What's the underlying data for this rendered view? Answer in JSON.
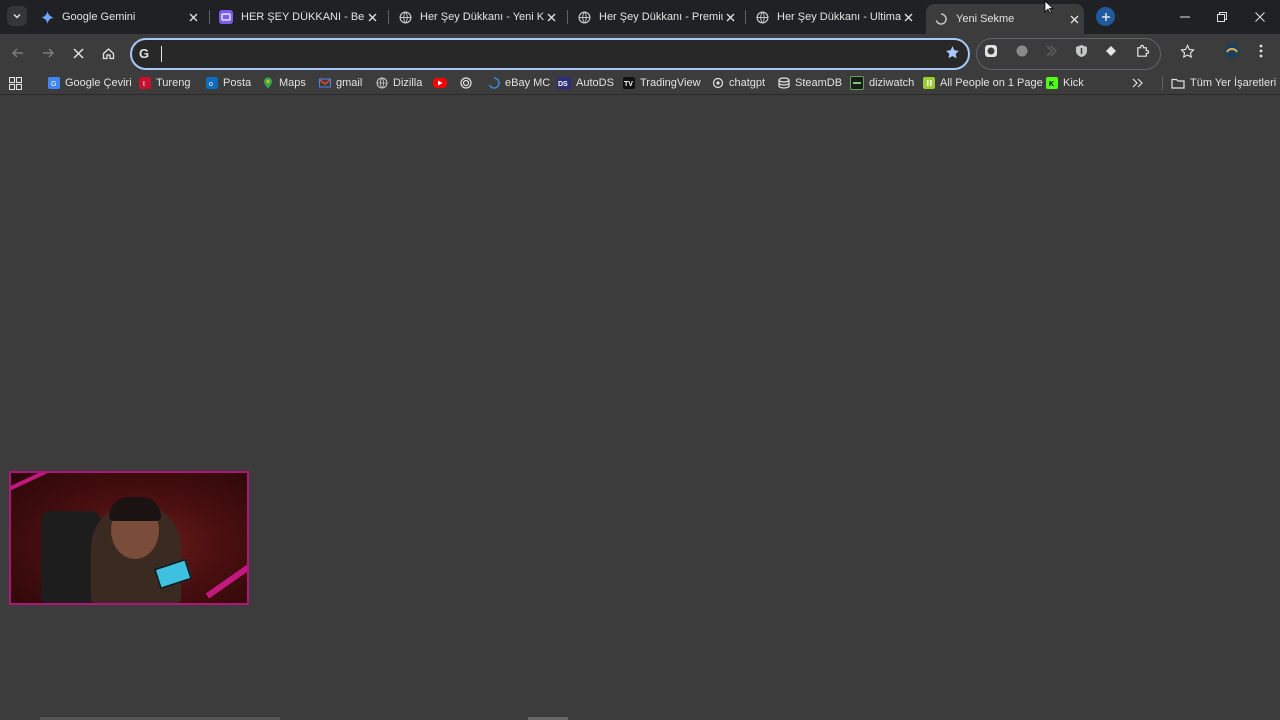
{
  "tabs": [
    {
      "title": "Google Gemini",
      "icon": "gemini-icon",
      "active": false
    },
    {
      "title": "HER ŞEY DÜKKANI - Belge",
      "icon": "canva-icon",
      "active": false
    },
    {
      "title": "Her Şey Dükkanı - Yeni Kor",
      "icon": "globe-icon",
      "active": false
    },
    {
      "title": "Her Şey Dükkanı - Premium",
      "icon": "globe-icon",
      "active": false
    },
    {
      "title": "Her Şey Dükkanı - Ultimate",
      "icon": "globe-icon",
      "active": false
    },
    {
      "title": "Yeni Sekme",
      "icon": "loading-icon",
      "active": true
    }
  ],
  "omnibox": {
    "value": "",
    "placeholder": ""
  },
  "bookmarks": [
    {
      "label": "Google Çeviri",
      "icon": "google-translate-icon"
    },
    {
      "label": "Tureng",
      "icon": "tureng-icon"
    },
    {
      "label": "Posta",
      "icon": "outlook-icon"
    },
    {
      "label": "Maps",
      "icon": "maps-icon"
    },
    {
      "label": "gmail",
      "icon": "gmail-icon"
    },
    {
      "label": "Dizilla",
      "icon": "dizilla-icon"
    },
    {
      "label": "",
      "icon": "youtube-icon"
    },
    {
      "label": "",
      "icon": "circle-icon"
    },
    {
      "label": "eBay MC",
      "icon": "ebay-icon"
    },
    {
      "label": "AutoDS",
      "icon": "autods-icon"
    },
    {
      "label": "TradingView",
      "icon": "tradingview-icon"
    },
    {
      "label": "chatgpt",
      "icon": "chatgpt-icon"
    },
    {
      "label": "SteamDB",
      "icon": "steamdb-icon"
    },
    {
      "label": "diziwatch",
      "icon": "diziwatch-icon"
    },
    {
      "label": "All People on 1 Page",
      "icon": "people-icon"
    },
    {
      "label": "Kick",
      "icon": "kick-icon"
    }
  ],
  "all_bookmarks_label": "Tüm Yer İşaretleri",
  "colors": {
    "accent": "#a8c7fa",
    "background": "#3c3c3c",
    "tabstrip": "#202124",
    "webcam_border": "#b0167a"
  }
}
